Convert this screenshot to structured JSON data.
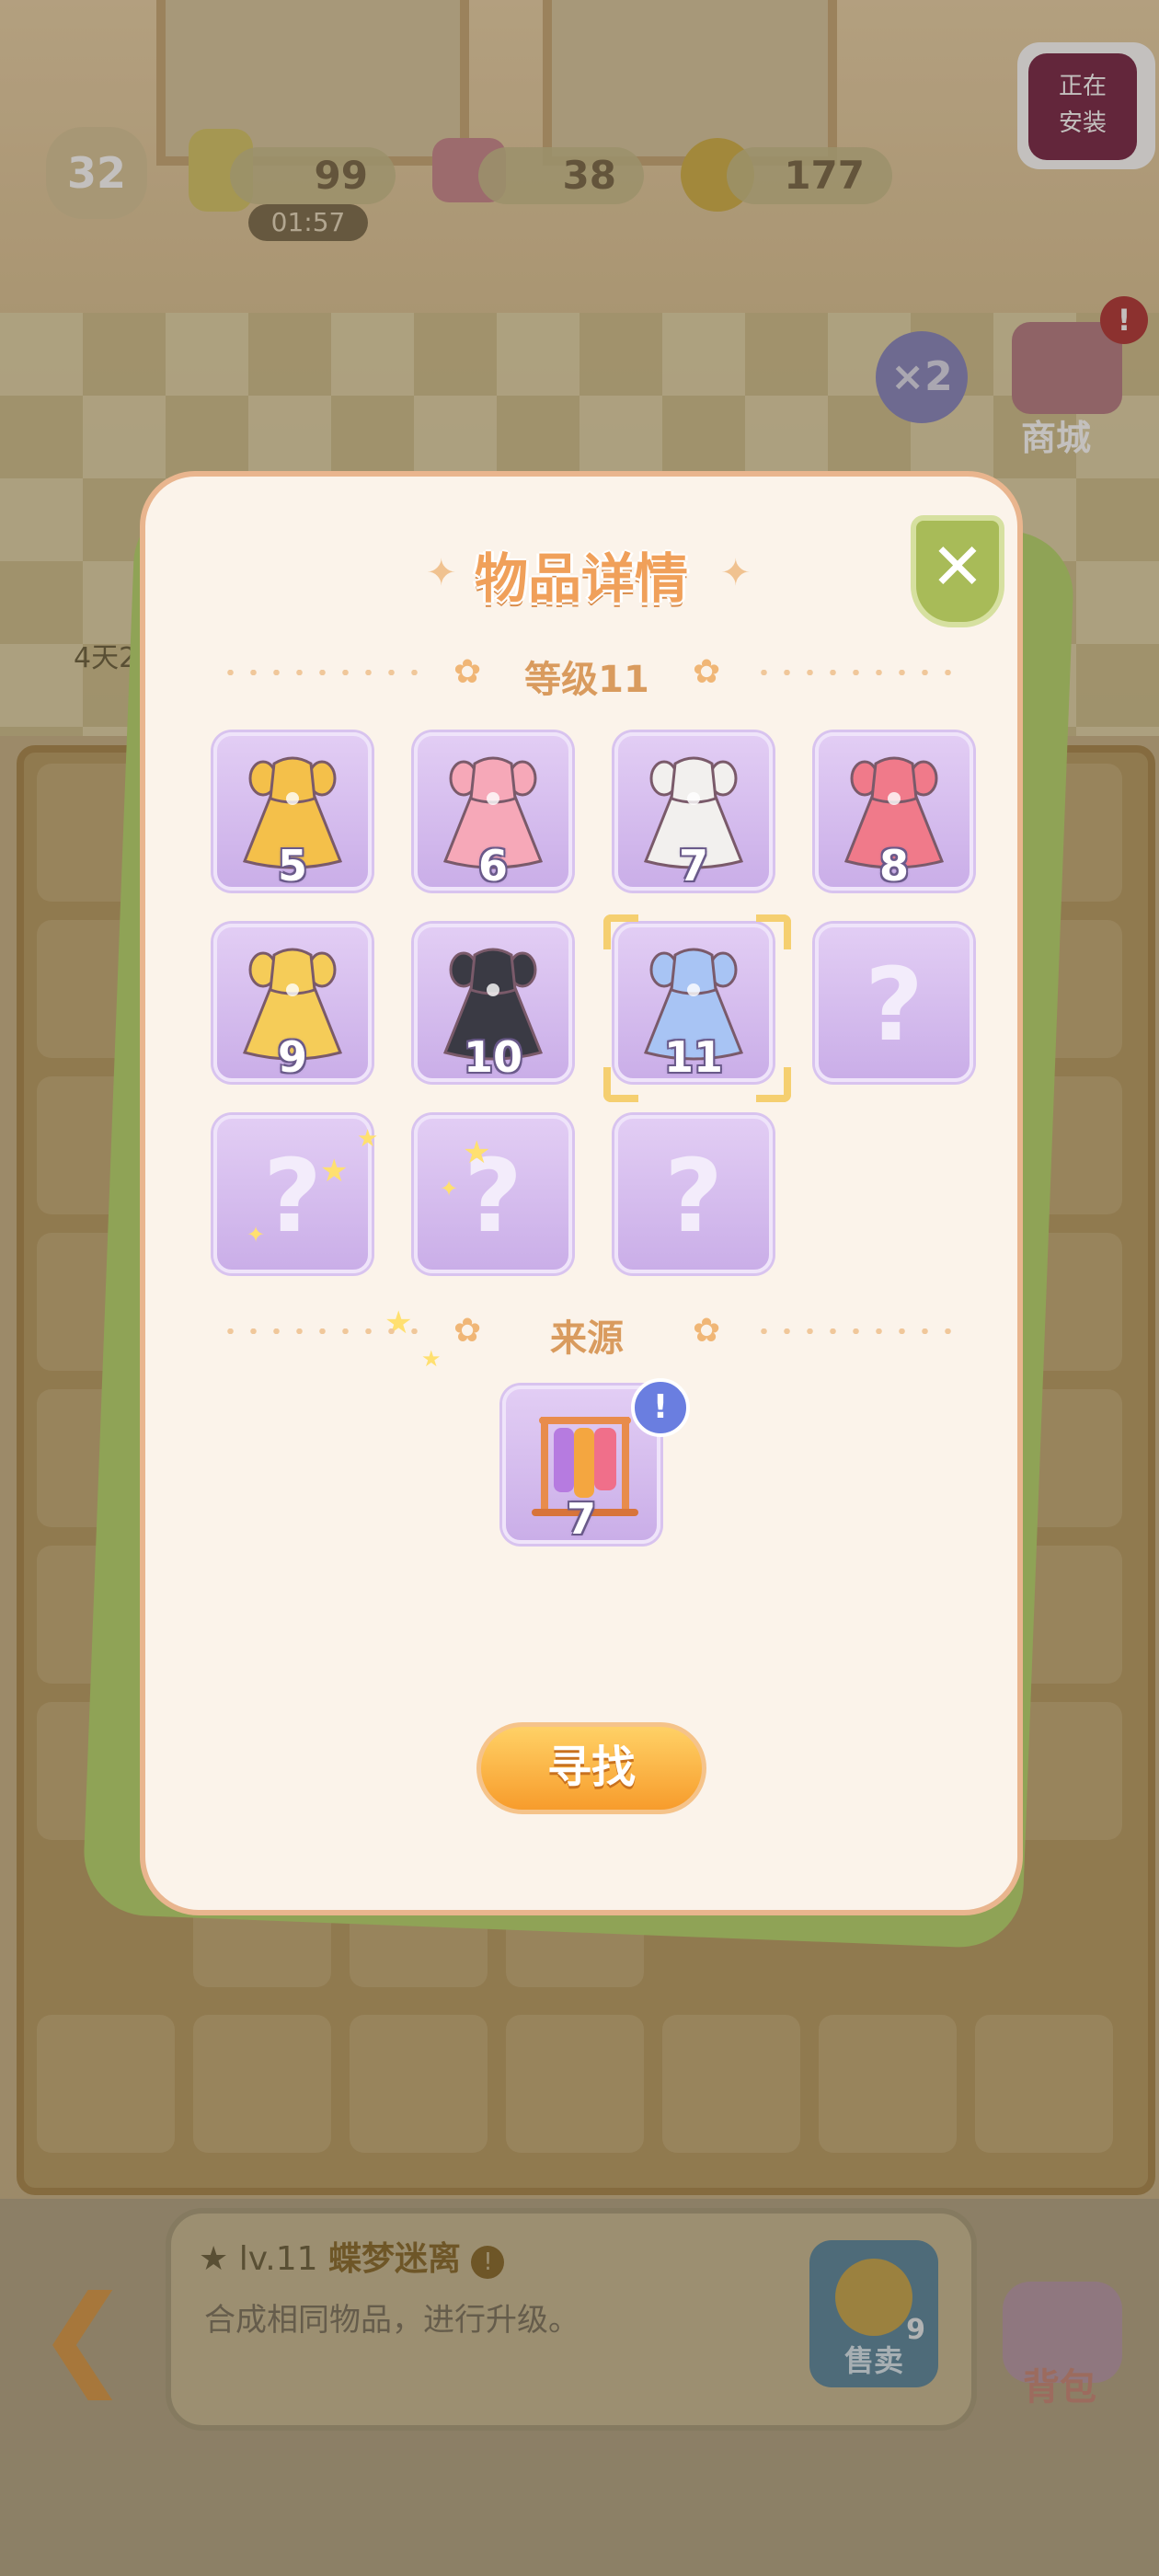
{
  "hud": {
    "level": "32",
    "energy": "99",
    "energy_timer": "01:57",
    "gems": "38",
    "coins": "177",
    "install_text_line1": "正在",
    "install_text_line2": "安装",
    "multiplier": "×2",
    "shop_label": "商城",
    "days_left": "4天2",
    "alert": "!"
  },
  "modal": {
    "title": "物品详情",
    "level_section": "等级11",
    "items": [
      {
        "level": "5",
        "icon": "gold-dress-icon",
        "color": "#f4c04a"
      },
      {
        "level": "6",
        "icon": "pink-dress-icon",
        "color": "#f6a8b8"
      },
      {
        "level": "7",
        "icon": "white-black-dress-icon",
        "color": "#f2f0ee"
      },
      {
        "level": "8",
        "icon": "red-pink-dress-icon",
        "color": "#f07a8a"
      },
      {
        "level": "9",
        "icon": "gold-gown-icon",
        "color": "#f5cc58"
      },
      {
        "level": "10",
        "icon": "black-rose-dress-icon",
        "color": "#3a3a44"
      },
      {
        "level": "11",
        "icon": "blue-flower-dress-icon",
        "color": "#a8c4f4"
      },
      {
        "level": "",
        "icon": "unknown-icon",
        "color": "#ffffff"
      },
      {
        "level": "",
        "icon": "unknown-icon",
        "color": "#ffffff"
      },
      {
        "level": "",
        "icon": "unknown-icon",
        "color": "#ffffff"
      },
      {
        "level": "",
        "icon": "unknown-icon",
        "color": "#ffffff"
      }
    ],
    "unknown_symbol": "?",
    "source_section": "来源",
    "source_item": {
      "level": "7",
      "icon": "clothes-rack-icon",
      "badge": "!"
    },
    "find_button": "寻找",
    "close_icon": "close-icon"
  },
  "info_bar": {
    "level_prefix": "lv.11",
    "item_name": "蝶梦迷离",
    "description": "合成相同物品，进行升级。",
    "sell_count": "9",
    "sell_label": "售卖",
    "bag_label": "背包"
  }
}
